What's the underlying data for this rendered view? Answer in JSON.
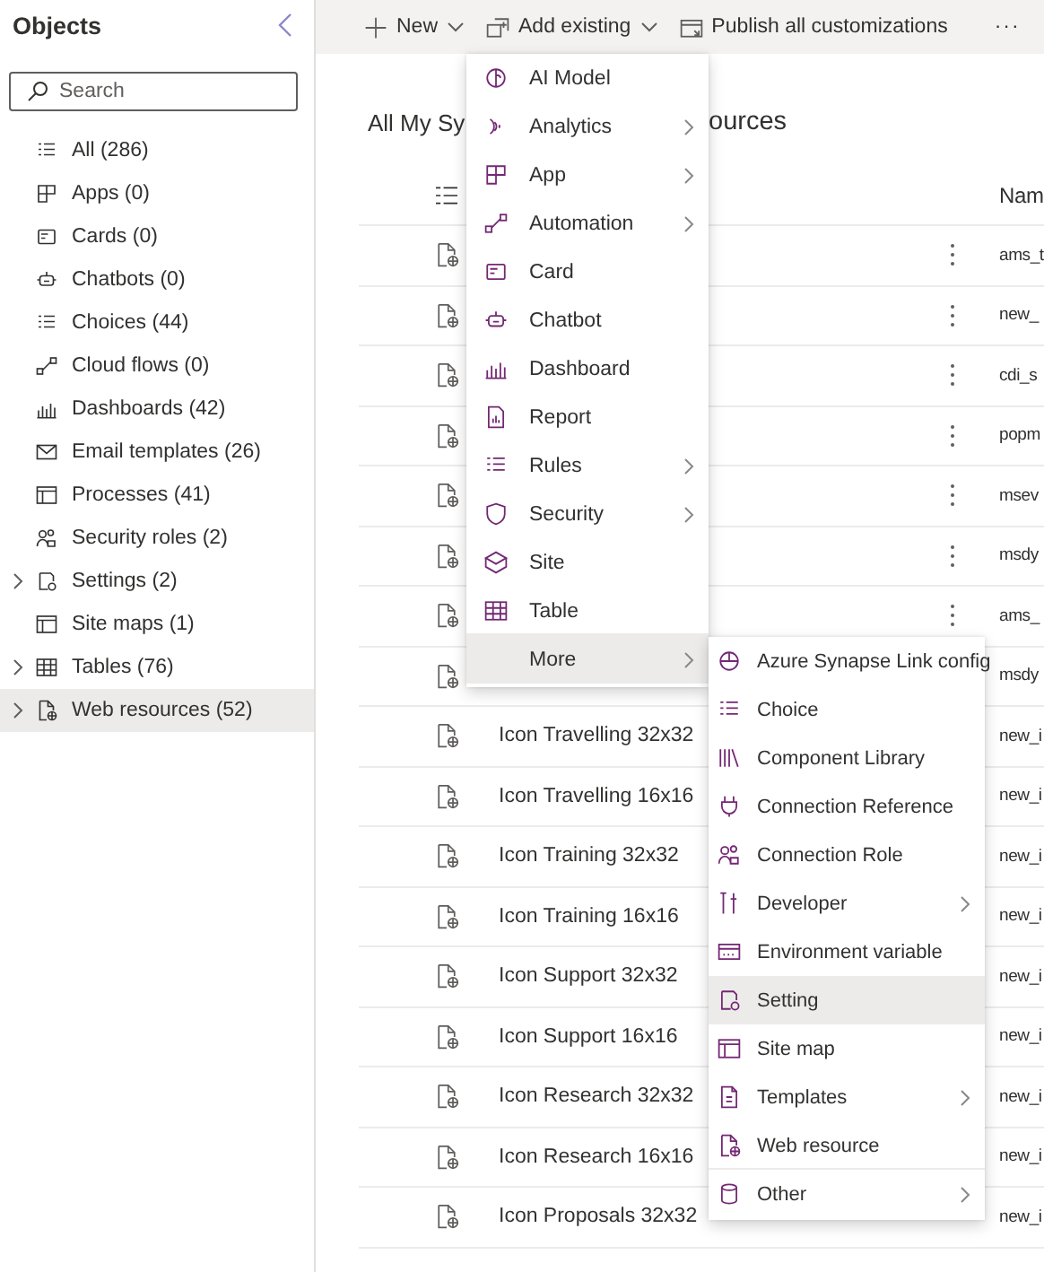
{
  "sidebar": {
    "title": "Objects",
    "search": {
      "placeholder": "Search"
    },
    "items": [
      {
        "label": "All (286)",
        "expandable": false,
        "selected": false
      },
      {
        "label": "Apps (0)",
        "expandable": false,
        "selected": false
      },
      {
        "label": "Cards (0)",
        "expandable": false,
        "selected": false
      },
      {
        "label": "Chatbots (0)",
        "expandable": false,
        "selected": false
      },
      {
        "label": "Choices (44)",
        "expandable": false,
        "selected": false
      },
      {
        "label": "Cloud flows (0)",
        "expandable": false,
        "selected": false
      },
      {
        "label": "Dashboards (42)",
        "expandable": false,
        "selected": false
      },
      {
        "label": "Email templates (26)",
        "expandable": false,
        "selected": false
      },
      {
        "label": "Processes (41)",
        "expandable": false,
        "selected": false
      },
      {
        "label": "Security roles (2)",
        "expandable": false,
        "selected": false
      },
      {
        "label": "Settings (2)",
        "expandable": true,
        "selected": false
      },
      {
        "label": "Site maps (1)",
        "expandable": false,
        "selected": false
      },
      {
        "label": "Tables (76)",
        "expandable": true,
        "selected": false
      },
      {
        "label": "Web resources (52)",
        "expandable": true,
        "selected": true
      }
    ]
  },
  "toolbar": {
    "buttons": [
      {
        "label": "New",
        "kind": "new"
      },
      {
        "label": "Add existing",
        "kind": "add"
      },
      {
        "label": "Publish all customizations",
        "kind": "publish"
      }
    ],
    "more": "···"
  },
  "heading": {
    "visible_start": "All My Sy",
    "visible_end": "ources"
  },
  "table": {
    "columns": {
      "column_3": "Nam"
    },
    "rows": [
      {
        "column_3": "ams_t",
        "more_button": true
      },
      {
        "column_3": "new_",
        "more_button": true
      },
      {
        "column_3": "cdi_s",
        "more_button": true
      },
      {
        "column_3": "popm",
        "more_button": true
      },
      {
        "column_3": "msev",
        "more_button": true
      },
      {
        "column_3": "msdy",
        "more_button": true
      },
      {
        "column_3": "ams_",
        "more_button": true
      },
      {
        "column_3": "msdy",
        "more_button": false
      },
      {
        "column_2": "Icon Travelling 32x32",
        "column_3": "new_i",
        "more_button": false
      },
      {
        "column_2": "Icon Travelling 16x16",
        "column_3": "new_i",
        "more_button": false
      },
      {
        "column_2": "Icon Training 32x32",
        "column_3": "new_i",
        "more_button": false
      },
      {
        "column_2": "Icon Training 16x16",
        "column_3": "new_i",
        "more_button": false
      },
      {
        "column_2": "Icon Support 32x32",
        "column_3": "new_i",
        "more_button": false
      },
      {
        "column_2": "Icon Support 16x16",
        "column_3": "new_i",
        "more_button": false
      },
      {
        "column_2": "Icon Research 32x32",
        "column_3": "new_i",
        "more_button": false
      },
      {
        "column_2": "Icon Research 16x16",
        "column_3": "new_i",
        "more_button": false
      },
      {
        "column_2": "Icon Proposals 32x32",
        "column_3": "new_i",
        "more_button": false
      }
    ]
  },
  "add_existing_menu": {
    "items": [
      {
        "label": "AI Model",
        "submenu": false,
        "selected": false
      },
      {
        "label": "Analytics",
        "submenu": true,
        "selected": false
      },
      {
        "label": "App",
        "submenu": true,
        "selected": false
      },
      {
        "label": "Automation",
        "submenu": true,
        "selected": false
      },
      {
        "label": "Card",
        "submenu": false,
        "selected": false
      },
      {
        "label": "Chatbot",
        "submenu": false,
        "selected": false
      },
      {
        "label": "Dashboard",
        "submenu": false,
        "selected": false
      },
      {
        "label": "Report",
        "submenu": false,
        "selected": false
      },
      {
        "label": "Rules",
        "submenu": true,
        "selected": false
      },
      {
        "label": "Security",
        "submenu": true,
        "selected": false
      },
      {
        "label": "Site",
        "submenu": false,
        "selected": false
      },
      {
        "label": "Table",
        "submenu": false,
        "selected": false
      },
      {
        "label": "More",
        "submenu": true,
        "selected": true,
        "children": [
          {
            "label": "Azure Synapse Link config",
            "submenu": false,
            "selected": false
          },
          {
            "label": "Choice",
            "submenu": false,
            "selected": false
          },
          {
            "label": "Component Library",
            "submenu": false,
            "selected": false
          },
          {
            "label": "Connection Reference",
            "submenu": false,
            "selected": false
          },
          {
            "label": "Connection Role",
            "submenu": false,
            "selected": false
          },
          {
            "label": "Developer",
            "submenu": true,
            "selected": false
          },
          {
            "label": "Environment variable",
            "submenu": false,
            "selected": false
          },
          {
            "label": "Setting",
            "submenu": false,
            "selected": true
          },
          {
            "label": "Site map",
            "submenu": false,
            "selected": false
          },
          {
            "label": "Templates",
            "submenu": true,
            "selected": false
          },
          {
            "label": "Web resource",
            "submenu": false,
            "selected": false
          },
          {
            "label": "Other",
            "submenu": true,
            "selected": false
          }
        ]
      }
    ]
  }
}
